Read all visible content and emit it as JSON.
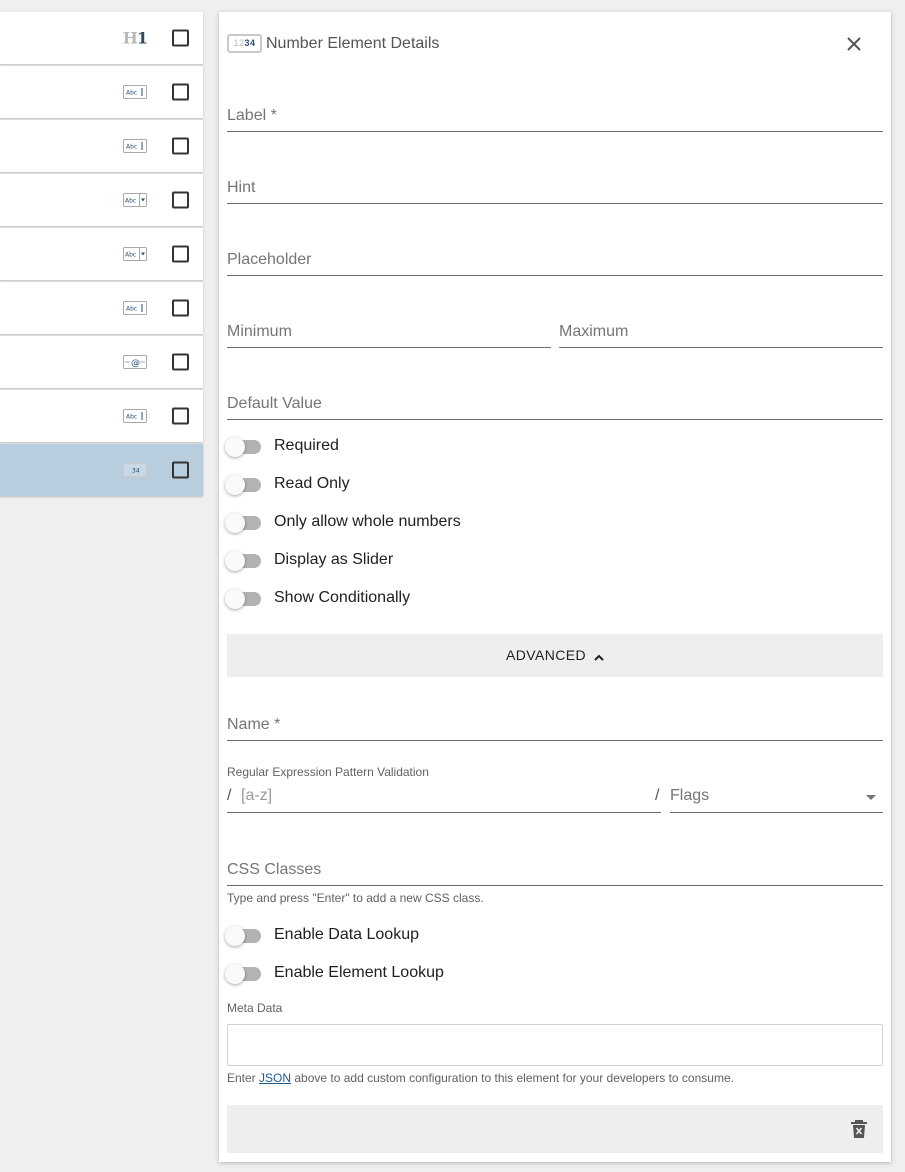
{
  "list": {
    "rows": [
      {
        "icon": "heading-icon",
        "h": "H",
        "num": "1",
        "selected": false
      },
      {
        "icon": "text-field-icon",
        "text": "Abc",
        "selected": false
      },
      {
        "icon": "text-field-icon",
        "text": "Abc",
        "selected": false
      },
      {
        "icon": "select-field-icon",
        "text": "Abc",
        "selected": false
      },
      {
        "icon": "select-field-icon",
        "text": "Abc",
        "selected": false
      },
      {
        "icon": "text-field-icon",
        "text": "Abc",
        "selected": false
      },
      {
        "icon": "email-field-icon",
        "text": "@",
        "selected": false
      },
      {
        "icon": "text-field-icon",
        "text": "Abc",
        "selected": false
      },
      {
        "icon": "number-field-icon",
        "text": "34",
        "selected": true
      }
    ]
  },
  "panel": {
    "icon_light": "12",
    "icon_dark": "34",
    "title": "Number Element Details",
    "fields": {
      "label": "Label *",
      "hint": "Hint",
      "placeholder": "Placeholder",
      "minimum": "Minimum",
      "maximum": "Maximum",
      "default_value": "Default Value"
    },
    "toggles": {
      "required": "Required",
      "read_only": "Read Only",
      "whole_numbers": "Only allow whole numbers",
      "slider": "Display as Slider",
      "conditional": "Show Conditionally"
    },
    "advanced_label": "ADVANCED",
    "advanced": {
      "name": "Name *",
      "regex_label": "Regular Expression Pattern Validation",
      "regex_slash": "/",
      "regex_placeholder": "[a-z]",
      "flags_slash": "/",
      "flags_label": "Flags",
      "css_classes": "CSS Classes",
      "css_hint": "Type and press \"Enter\" to add a new CSS class.",
      "data_lookup": "Enable Data Lookup",
      "element_lookup": "Enable Element Lookup",
      "meta_label": "Meta Data",
      "meta_hint_prefix": "Enter ",
      "meta_hint_link": "JSON",
      "meta_hint_suffix": " above to add custom configuration to this element for your developers to consume."
    }
  },
  "colors": {
    "selected_row": "#b8cedf",
    "brand_dark": "#2a4d6e",
    "link": "#1f5b8f"
  }
}
